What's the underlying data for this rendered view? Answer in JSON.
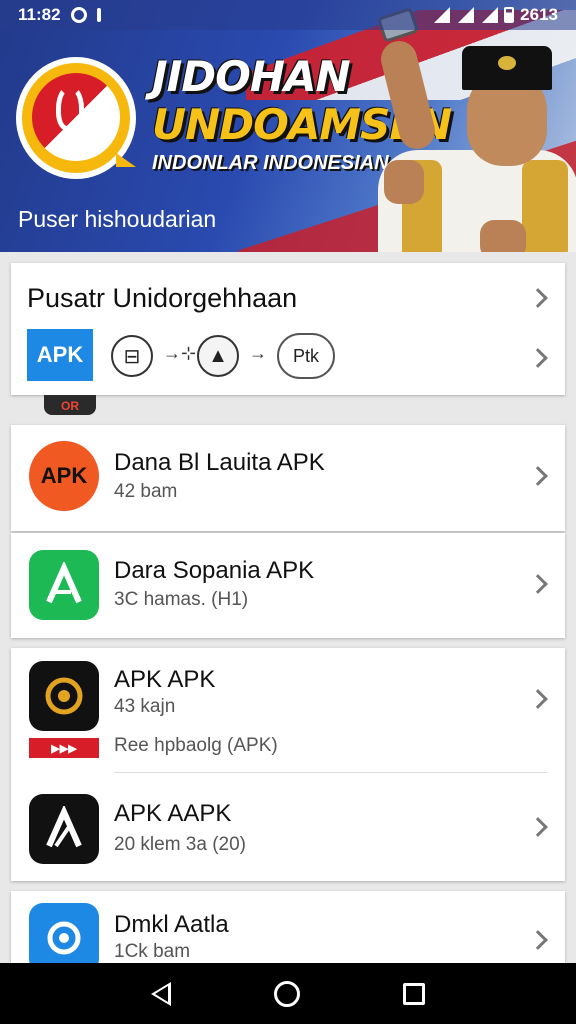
{
  "status_bar": {
    "time": "11:82",
    "battery_text": "2613"
  },
  "banner": {
    "title_line1": "JIDOHAN",
    "title_line2": "UNDOAMSEN",
    "subtitle": "INDONLAR INDONESIAN",
    "caption": "Puser hishoudarian"
  },
  "featured": {
    "title": "Pusatr Unidorgehhaan",
    "apk_label": "APK",
    "pill_label": "Ptk",
    "peek_label": "OR"
  },
  "apps": [
    {
      "name": "Dana Bl Lauita APK",
      "meta": "42 bam",
      "icon_text": "APK",
      "icon_color": "#f05a22"
    },
    {
      "name": "Dara Sopania APK",
      "meta": "3C hamas.  (H1)",
      "icon_color": "#1db954"
    },
    {
      "name": "APK APK",
      "meta": "43 kajn",
      "extra": "Ree hpbaolg (APK)",
      "icon_color": "#111111"
    },
    {
      "name": "APK AAPK",
      "meta": "20 klem 3a  (20)",
      "icon_color": "#111111"
    },
    {
      "name": "Dmkl Aatla",
      "meta": "1Ck bam",
      "icon_color": "#1e88e5"
    }
  ]
}
